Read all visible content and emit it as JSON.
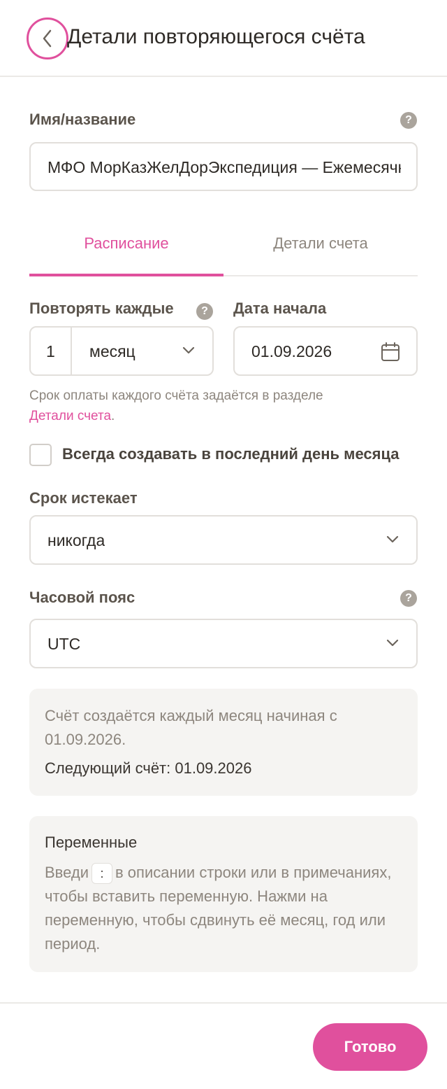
{
  "header": {
    "title": "Детали повторяющегося счёта",
    "back_icon": "chevron-left-icon"
  },
  "name_field": {
    "label": "Имя/название",
    "value": "МФО МорКазЖелДорЭкспедиция — Ежемесячно"
  },
  "tabs": [
    {
      "label": "Расписание",
      "active": true
    },
    {
      "label": "Детали счета",
      "active": false
    }
  ],
  "repeat": {
    "label": "Повторять каждые",
    "count": "1",
    "unit": "месяц"
  },
  "start_date": {
    "label": "Дата начала",
    "value": "01.09.2026",
    "icon": "calendar-icon"
  },
  "hint": {
    "text": "Срок оплаты каждого счёта задаётся в разделе ",
    "link": "Детали счета",
    "suffix": "."
  },
  "last_day_checkbox": {
    "label": "Всегда создавать в последний день месяца",
    "checked": false
  },
  "expires": {
    "label": "Срок истекает",
    "value": "никогда"
  },
  "timezone": {
    "label": "Часовой пояс",
    "value": "UTC"
  },
  "summary": {
    "text": "Счёт создаётся каждый месяц начиная с 01.09.2026.",
    "next": "Следующий счёт: 01.09.2026"
  },
  "variables": {
    "title": "Переменные",
    "text_before": "Введи",
    "chip": ":",
    "text_after": "в описании строки или в примечаниях, чтобы вставить переменную. Нажми на переменную, чтобы сдвинуть её месяц, год или период."
  },
  "footer": {
    "done_label": "Готово"
  },
  "help_glyph": "?",
  "colors": {
    "accent": "#e0509d",
    "muted": "#8d867e",
    "border": "#e2dfdb"
  }
}
